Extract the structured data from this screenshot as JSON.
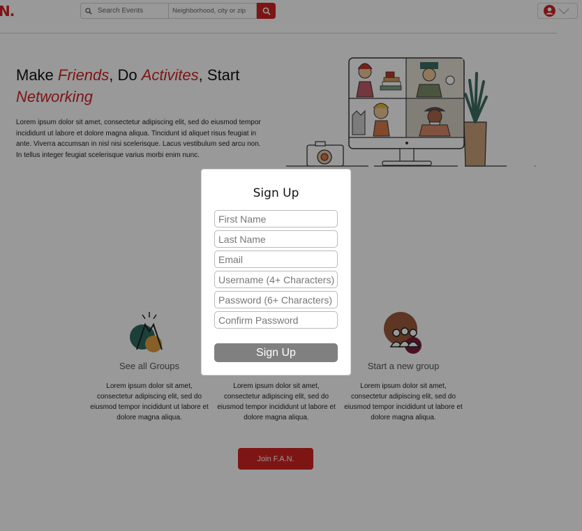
{
  "header": {
    "logo": "N.",
    "search_events_placeholder": "Search Events",
    "search_location_placeholder": "Neighborhood, city or zip"
  },
  "hero": {
    "title_parts": [
      "Make ",
      "Friends",
      ", Do ",
      "Activites",
      ", Start ",
      "Networking"
    ],
    "text": "Lorem ipsum dolor sit amet, consectetur adipiscing elit, sed do eiusmod tempor incididunt ut labore et dolore magna aliqua. Tincidunt id aliquet risus feugiat in ante. Viverra accumsan in nisl nisi scelerisque. Lacus vestibulum sed arcu non. In tellus integer feugiat scelerisque varius morbi enim nunc."
  },
  "features": [
    {
      "title": "See all Groups",
      "text": "Lorem ipsum dolor sit amet, consectetur adipiscing elit, sed do eiusmod tempor incididunt ut labore et dolore magna aliqua."
    },
    {
      "title": "",
      "text": "Lorem ipsum dolor sit amet, consectetur adipiscing elit, sed do eiusmod tempor incididunt ut labore et dolore magna aliqua."
    },
    {
      "title": "Start a new group",
      "text": "Lorem ipsum dolor sit amet, consectetur adipiscing elit, sed do eiusmod tempor incididunt ut labore et dolore magna aliqua."
    }
  ],
  "join_button": "Join F.A.N.",
  "signup_modal": {
    "title": "Sign Up",
    "fields": {
      "first_name": "First Name",
      "last_name": "Last Name",
      "email": "Email",
      "username": "Username (4+ Characters)",
      "password": "Password (6+ Characters)",
      "confirm_password": "Confirm Password"
    },
    "submit_label": "Sign Up"
  },
  "colors": {
    "brand_red": "#d32323",
    "overlay": "rgba(0,0,0,0.40)",
    "submit_gray": "#808080"
  },
  "icons": [
    "search-icon",
    "user-avatar-icon",
    "chevron-down-icon",
    "high-five-icon",
    "group-people-icon"
  ]
}
